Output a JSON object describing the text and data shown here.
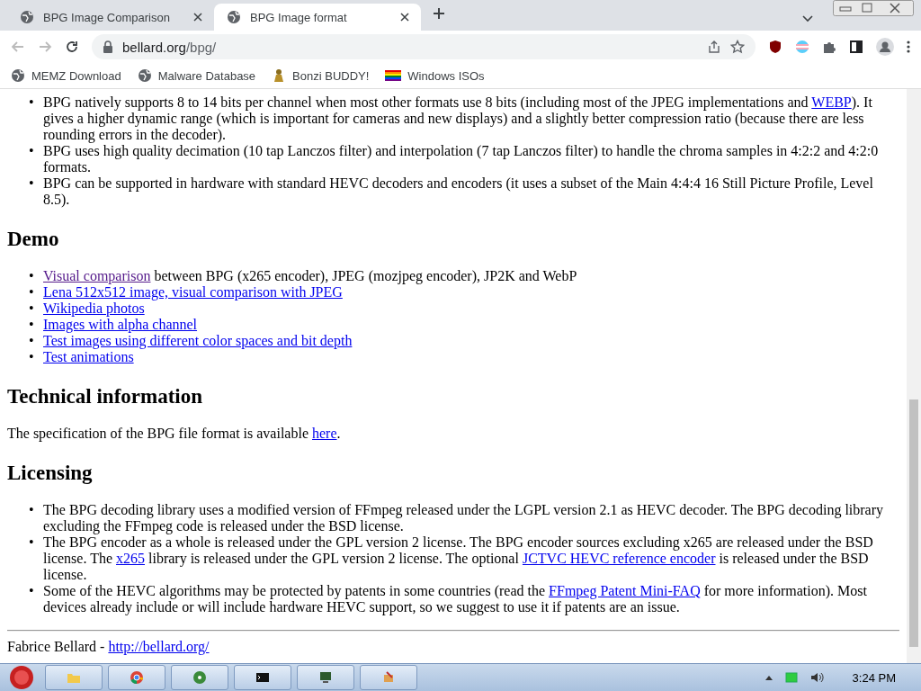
{
  "tabs": [
    {
      "title": "BPG Image Comparison",
      "selected": false
    },
    {
      "title": "BPG Image format",
      "selected": true
    }
  ],
  "address": {
    "host": "bellard.org",
    "path": "/bpg/"
  },
  "bookmarks": [
    {
      "label": "MEMZ Download",
      "kind": "globe"
    },
    {
      "label": "Malware Database",
      "kind": "globe"
    },
    {
      "label": "Bonzi BUDDY!",
      "kind": "figure"
    },
    {
      "label": "Windows ISOs",
      "kind": "rainbow"
    }
  ],
  "page": [
    {
      "kind": "list",
      "marker": "•",
      "items": [
        [
          {
            "text": "BPG natively supports 8 to 14 bits per channel when most other formats use 8 bits (including most of the JPEG implementations and "
          },
          {
            "link": "WEBP",
            "visited": false
          },
          {
            "text": "). It gives a higher dynamic range (which is important for cameras and new displays) and a slightly better compression ratio (because there are less rounding errors in the decoder)."
          }
        ],
        [
          {
            "text": "BPG uses high quality decimation (10 tap Lanczos filter) and interpolation (7 tap Lanczos filter) to handle the chroma samples in 4:2:2 and 4:2:0 formats."
          }
        ],
        [
          {
            "text": "BPG can be supported in hardware with standard HEVC decoders and encoders (it uses a subset of the Main 4:4:4 16 Still Picture Profile, Level 8.5)."
          }
        ]
      ]
    },
    {
      "kind": "heading",
      "text": "Demo"
    },
    {
      "kind": "list",
      "marker": "•",
      "items": [
        [
          {
            "link": "Visual comparison",
            "visited": true
          },
          {
            "text": " between BPG (x265 encoder), JPEG (mozjpeg encoder), JP2K and WebP"
          }
        ],
        [
          {
            "link": "Lena 512x512 image, visual comparison with JPEG",
            "visited": false
          }
        ],
        [
          {
            "link": "Wikipedia photos",
            "visited": false
          }
        ],
        [
          {
            "link": "Images with alpha channel",
            "visited": false
          }
        ],
        [
          {
            "link": "Test images using different color spaces and bit depth",
            "visited": false
          }
        ],
        [
          {
            "link": "Test animations",
            "visited": false
          }
        ]
      ]
    },
    {
      "kind": "heading",
      "text": "Technical information"
    },
    {
      "kind": "paragraph",
      "parts": [
        {
          "text": "The specification of the BPG file format is available "
        },
        {
          "link": "here",
          "visited": false
        },
        {
          "text": "."
        }
      ]
    },
    {
      "kind": "heading",
      "text": "Licensing"
    },
    {
      "kind": "list",
      "marker": "•",
      "items": [
        [
          {
            "text": "The BPG decoding library uses a modified version of FFmpeg released under the LGPL version 2.1 as HEVC decoder. The BPG decoding library excluding the FFmpeg code is released under the BSD license."
          }
        ],
        [
          {
            "text": "The BPG encoder as a whole is released under the GPL version 2 license. The BPG encoder sources excluding x265 are released under the BSD license. The "
          },
          {
            "link": "x265",
            "visited": false
          },
          {
            "text": " library is released under the GPL version 2 license. The optional "
          },
          {
            "link": "JCTVC HEVC reference encoder",
            "visited": false
          },
          {
            "text": " is released under the BSD license."
          }
        ],
        [
          {
            "text": "Some of the HEVC algorithms may be protected by patents in some countries (read the "
          },
          {
            "link": "FFmpeg Patent Mini-FAQ",
            "visited": false
          },
          {
            "text": " for more information). Most devices already include or will include hardware HEVC support, so we suggest to use it if patents are an issue."
          }
        ]
      ]
    },
    {
      "kind": "rule"
    },
    {
      "kind": "paragraph",
      "parts": [
        {
          "text": "Fabrice Bellard - "
        },
        {
          "link": "http://bellard.org/",
          "visited": false
        }
      ]
    }
  ],
  "taskbar": {
    "clock": "3:24 PM"
  }
}
